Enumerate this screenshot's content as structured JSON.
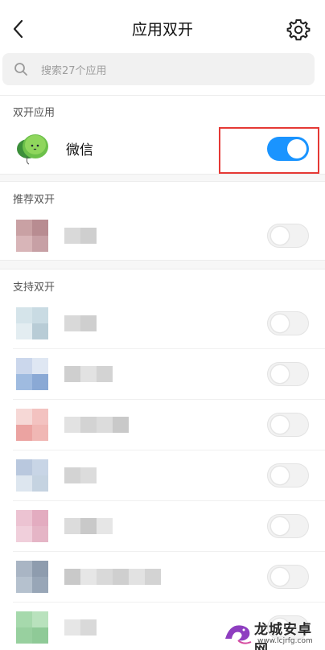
{
  "header": {
    "title": "应用双开",
    "back_icon": "chevron-left-icon",
    "settings_icon": "gear-icon"
  },
  "search": {
    "placeholder": "搜索27个应用",
    "icon": "search-icon"
  },
  "sections": {
    "dual_apps": {
      "title": "双开应用"
    },
    "recommended": {
      "title": "推荐双开"
    },
    "supported": {
      "title": "支持双开"
    }
  },
  "dual_apps": [
    {
      "name": "微信",
      "enabled": true,
      "icon": "wechat-icon"
    }
  ],
  "recommended_apps": [
    {
      "enabled": false,
      "colors": [
        "#c9a1a4",
        "#b88c91",
        "#d8b5b8",
        "#c7a0a5"
      ]
    }
  ],
  "supported_apps": [
    {
      "enabled": false,
      "colors": [
        "#d5e4ea",
        "#c9dbe3",
        "#e3edf1",
        "#b8ccd6"
      ]
    },
    {
      "enabled": false,
      "colors": [
        "#cbd7ec",
        "#dfe7f3",
        "#9fbbe0",
        "#8aa9d5"
      ]
    },
    {
      "enabled": false,
      "colors": [
        "#f6d8d6",
        "#f3c2c0",
        "#eba3a1",
        "#f0b7b4"
      ]
    },
    {
      "enabled": false,
      "colors": [
        "#b9c8de",
        "#c8d5e6",
        "#dde6ef",
        "#c5d3e1"
      ]
    },
    {
      "enabled": false,
      "colors": [
        "#ecc3d2",
        "#e3acc0",
        "#f0cfdb",
        "#e5b5c6"
      ]
    },
    {
      "enabled": false,
      "colors": [
        "#a9b5c4",
        "#8e9cae",
        "#b5c1ce",
        "#98a6b7"
      ]
    },
    {
      "enabled": false,
      "colors": [
        "#a6d9ac",
        "#b9e2bd",
        "#98d09f",
        "#8fca97"
      ]
    }
  ],
  "accent_color": "#1a94ff",
  "highlight_color": "#e53935",
  "watermark": {
    "title": "龙城安卓网",
    "url": "www.lcjrfg.com"
  }
}
